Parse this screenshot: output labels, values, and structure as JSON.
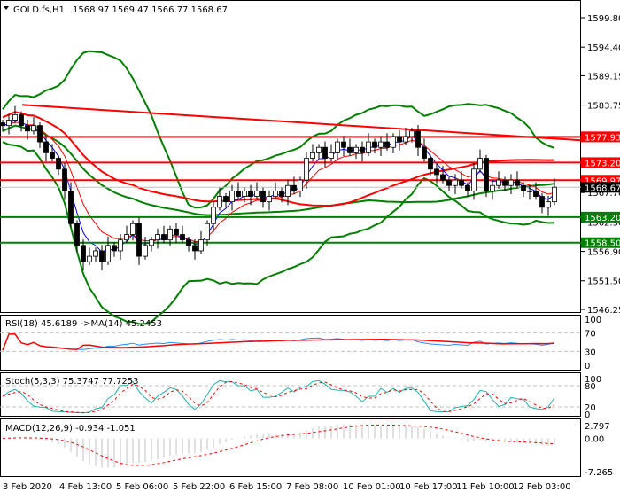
{
  "header": {
    "symbol_label": "GOLD.fs,H1",
    "ohlc": "1568.97 1569.47 1566.77 1568.67",
    "collapse_icon": "triangle-down-icon"
  },
  "indicators": {
    "rsi_label": "RSI(18) 45.6189  ->MA(14) 45.2453",
    "stoch_label": "Stoch(5,3,3) 75.3747 77.7253",
    "macd_label": "MACD(12,26,9) -0.934 -1.051"
  },
  "colors": {
    "resistance": "#ff0000",
    "support": "#008000",
    "current": "#000000",
    "rsi": "#1e90ff",
    "stoch": "#20b2aa",
    "signal": "#ff0000",
    "histogram": "#c0c0c0"
  },
  "chart_data": {
    "type": "candlestick",
    "title": "GOLD.fs,H1",
    "ylim": [
      1546.25,
      1599.8
    ],
    "price_ticks": [
      "1599.80",
      "1594.40",
      "1589.15",
      "1583.75",
      "1567.70",
      "1562.30",
      "1556.90",
      "1551.50",
      "1546.25"
    ],
    "x_ticks": [
      "3 Feb 2020",
      "4 Feb 13:00",
      "5 Feb 06:00",
      "5 Feb 22:00",
      "6 Feb 15:00",
      "7 Feb 08:00",
      "10 Feb 01:00",
      "10 Feb 17:00",
      "11 Feb 10:00",
      "12 Feb 03:00"
    ],
    "closes": [
      1580,
      1581,
      1582,
      1580,
      1579,
      1580,
      1577,
      1575,
      1574,
      1572,
      1568,
      1562,
      1558,
      1555,
      1556,
      1557,
      1555,
      1558,
      1557,
      1559,
      1560,
      1562,
      1556,
      1558,
      1559,
      1560,
      1559,
      1561,
      1560,
      1559,
      1558,
      1557,
      1559,
      1562,
      1565,
      1567,
      1566,
      1568,
      1567,
      1568,
      1567,
      1568,
      1566,
      1567,
      1568,
      1567,
      1569,
      1568,
      1570,
      1574,
      1575,
      1576,
      1574,
      1575,
      1577,
      1576,
      1575,
      1576,
      1575,
      1577,
      1576,
      1577,
      1576,
      1578,
      1577,
      1578,
      1579,
      1576,
      1574,
      1572,
      1571,
      1570,
      1569,
      1570,
      1569,
      1568,
      1572,
      1574,
      1568,
      1569,
      1570,
      1569,
      1570,
      1569,
      1568,
      1568,
      1567,
      1565,
      1566,
      1568.67
    ],
    "levels": [
      {
        "price": 1577.93,
        "label": "1577.93",
        "kind": "resistance"
      },
      {
        "price": 1573.2,
        "label": "1573.20",
        "kind": "resistance"
      },
      {
        "price": 1569.97,
        "label": "1569.97",
        "kind": "resistance"
      },
      {
        "price": 1568.67,
        "label": "1568.67",
        "kind": "current"
      },
      {
        "price": 1563.2,
        "label": "1563.20",
        "kind": "support"
      },
      {
        "price": 1558.5,
        "label": "1558.50",
        "kind": "support"
      }
    ],
    "trendline": {
      "start_price": 1583.8,
      "end_price": 1577.3
    },
    "rsi_levels": [
      "100",
      "70",
      "30",
      "0"
    ],
    "stoch_levels": [
      "100",
      "80",
      "20",
      "0"
    ],
    "macd_levels": [
      "2.797",
      "0.00",
      "-7.265"
    ]
  }
}
